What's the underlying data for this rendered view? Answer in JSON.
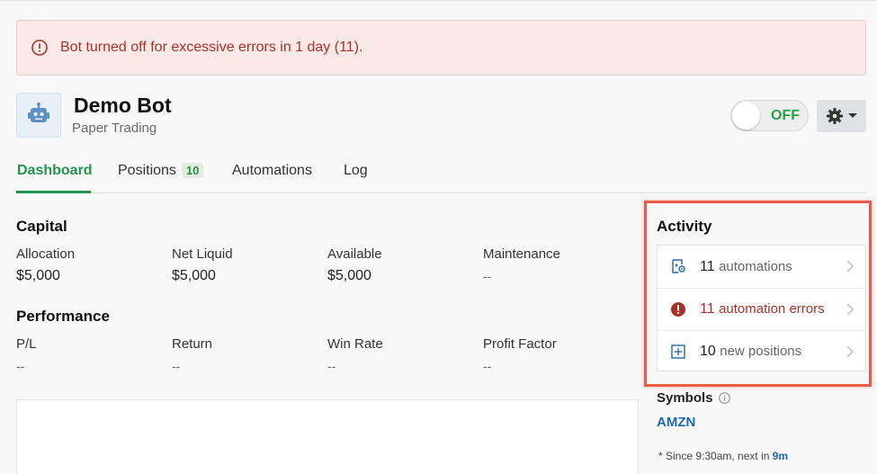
{
  "alert": {
    "message": "Bot turned off for excessive errors in 1 day (11).",
    "icon": "alert-circle-icon",
    "color": "#a8322a"
  },
  "bot": {
    "name": "Demo Bot",
    "mode": "Paper Trading",
    "icon": "robot-icon",
    "toggle_label": "OFF",
    "settings_icon": "gear-icon"
  },
  "tabs": [
    {
      "label": "Dashboard",
      "active": true
    },
    {
      "label": "Positions",
      "badge": "10"
    },
    {
      "label": "Automations"
    },
    {
      "label": "Log"
    }
  ],
  "capital": {
    "title": "Capital",
    "metrics": [
      {
        "label": "Allocation",
        "value": "$5,000"
      },
      {
        "label": "Net Liquid",
        "value": "$5,000"
      },
      {
        "label": "Available",
        "value": "$5,000"
      },
      {
        "label": "Maintenance",
        "value": "--"
      }
    ]
  },
  "performance": {
    "title": "Performance",
    "metrics": [
      {
        "label": "P/L",
        "value": "--"
      },
      {
        "label": "Return",
        "value": "--"
      },
      {
        "label": "Win Rate",
        "value": "--"
      },
      {
        "label": "Profit Factor",
        "value": "--"
      }
    ]
  },
  "activity": {
    "title": "Activity",
    "items": [
      {
        "count": "11",
        "label": "automations",
        "icon": "automation-icon"
      },
      {
        "count": "11",
        "label": "automation errors",
        "icon": "error-icon"
      },
      {
        "count": "10",
        "label": "new positions",
        "icon": "plus-square-icon"
      }
    ]
  },
  "symbols": {
    "title": "Symbols",
    "items": [
      "AMZN"
    ],
    "note_prefix": "* Since 9:30am, next in",
    "note_time": "9m"
  },
  "colors": {
    "accent_green": "#23954a",
    "error_red": "#a8322a",
    "link_blue": "#2069a8",
    "highlight": "#e95b4b"
  }
}
